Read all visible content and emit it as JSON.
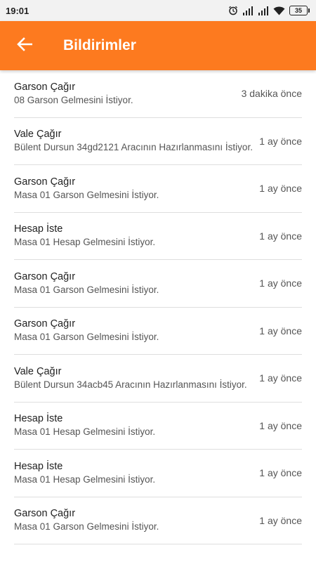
{
  "status_bar": {
    "time": "19:01",
    "battery": "35"
  },
  "app_bar": {
    "title": "Bildirimler",
    "color": "#fd7a1f"
  },
  "notifications": [
    {
      "title": "Garson Çağır",
      "body": "08 Garson Gelmesini İstiyor.",
      "time": "3 dakika önce"
    },
    {
      "title": "Vale Çağır",
      "body": "Bülent Dursun 34gd2121 Aracının Hazırlanmasını İstiyor.",
      "time": "1 ay önce"
    },
    {
      "title": "Garson Çağır",
      "body": "Masa 01 Garson Gelmesini İstiyor.",
      "time": "1 ay önce"
    },
    {
      "title": "Hesap İste",
      "body": "Masa 01 Hesap Gelmesini İstiyor.",
      "time": "1 ay önce"
    },
    {
      "title": "Garson Çağır",
      "body": "Masa 01 Garson Gelmesini İstiyor.",
      "time": "1 ay önce"
    },
    {
      "title": "Garson Çağır",
      "body": "Masa 01 Garson Gelmesini İstiyor.",
      "time": "1 ay önce"
    },
    {
      "title": "Vale Çağır",
      "body": "Bülent Dursun 34acb45 Aracının Hazırlanmasını İstiyor.",
      "time": "1 ay önce"
    },
    {
      "title": "Hesap İste",
      "body": "Masa 01 Hesap Gelmesini İstiyor.",
      "time": "1 ay önce"
    },
    {
      "title": "Hesap İste",
      "body": "Masa 01 Hesap Gelmesini İstiyor.",
      "time": "1 ay önce"
    },
    {
      "title": "Garson Çağır",
      "body": "Masa 01 Garson Gelmesini İstiyor.",
      "time": "1 ay önce"
    }
  ]
}
